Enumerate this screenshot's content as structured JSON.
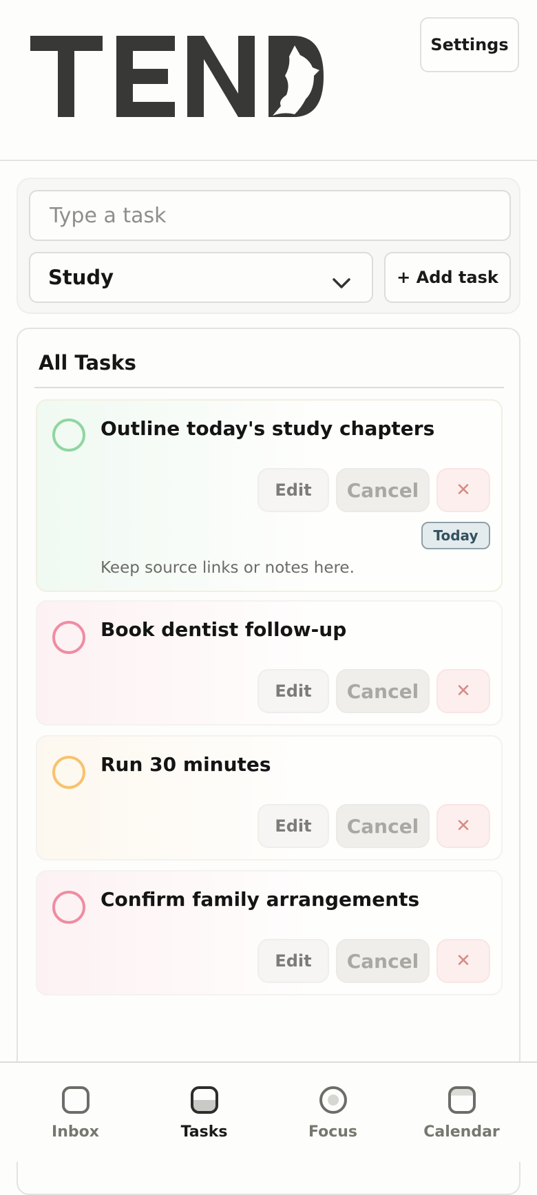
{
  "header": {
    "logo_text": "TEND",
    "settings_label": "Settings"
  },
  "composer": {
    "input_placeholder": "Type a task",
    "input_value": "",
    "category_selected": "Study",
    "add_label": "+ Add task"
  },
  "tasks": {
    "title": "All Tasks",
    "edit_label": "Edit",
    "cancel_label": "Cancel",
    "delete_glyph": "✕",
    "items": [
      {
        "title": "Outline today's study chapters",
        "badge": "Today",
        "note": "Keep source links or notes here.",
        "accent": "#8fd6a1",
        "tint": "#f0f9f2"
      },
      {
        "title": "Book dentist follow-up",
        "badge": "",
        "note": "",
        "accent": "#f08ca2",
        "tint": "#fdf1f3"
      },
      {
        "title": "Run 30 minutes",
        "badge": "",
        "note": "",
        "accent": "#f8c26c",
        "tint": "#fdf8ef"
      },
      {
        "title": "Confirm family arrangements",
        "badge": "",
        "note": "",
        "accent": "#f08ca2",
        "tint": "#fdf1f3"
      }
    ]
  },
  "nav": {
    "items": [
      {
        "label": "Inbox",
        "icon": "inbox-icon",
        "active": false
      },
      {
        "label": "Tasks",
        "icon": "tasks-icon",
        "active": true
      },
      {
        "label": "Focus",
        "icon": "focus-icon",
        "active": false
      },
      {
        "label": "Calendar",
        "icon": "calendar-icon",
        "active": false
      }
    ]
  },
  "colors": {
    "text": "#161616",
    "muted": "#77776f",
    "background": "#fdfdfb",
    "logo": "#383836"
  }
}
